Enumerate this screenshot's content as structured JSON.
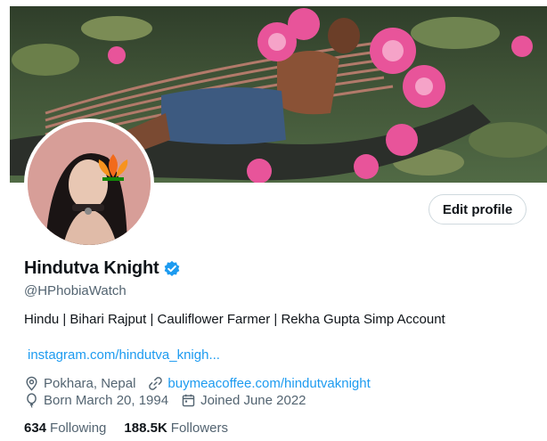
{
  "colors": {
    "accent": "#1d9bf0",
    "text": "#0f1419",
    "secondary_text": "#536471",
    "border": "#cfd9de",
    "lotus_pink": "#e8549a"
  },
  "profile": {
    "display_name": "Hindutva Knight",
    "handle": "@HPhobiaWatch",
    "bio": "Hindu | Bihari Rajput | Cauliflower Farmer | Rekha Gupta Simp Account",
    "link": "instagram.com/hindutva_knigh...",
    "verified_icon": "verified-badge-icon",
    "edit_button_label": "Edit profile"
  },
  "meta": {
    "location": "Pokhara, Nepal",
    "location_icon": "map-pin-icon",
    "website": "buymeacoffee.com/hindutvaknight",
    "website_icon": "link-icon",
    "birthday": "Born March 20, 1994",
    "birthday_icon": "balloon-icon",
    "joined": "Joined June 2022",
    "joined_icon": "calendar-icon"
  },
  "stats": {
    "following_count": "634",
    "following_label": "Following",
    "followers_count": "188.5K",
    "followers_label": "Followers"
  }
}
